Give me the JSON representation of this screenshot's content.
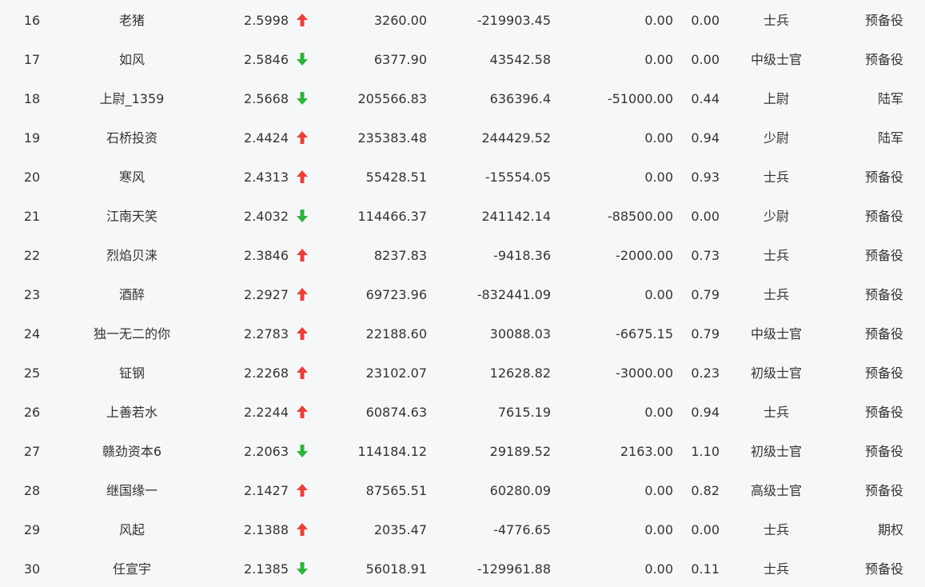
{
  "colors": {
    "up": "#e8413c",
    "down": "#2fb23f",
    "text": "#333333",
    "background": "#f6f7f9"
  },
  "rows": [
    {
      "rank": "16",
      "name": "老猪",
      "score": "2.5998",
      "trend": "up",
      "trend_icon": "arrow-up-icon",
      "value1": "3260.00",
      "value2": "-219903.45",
      "value3": "0.00",
      "ratio": "0.00",
      "title": "士兵",
      "category": "预备役"
    },
    {
      "rank": "17",
      "name": "如风",
      "score": "2.5846",
      "trend": "down",
      "trend_icon": "arrow-down-icon",
      "value1": "6377.90",
      "value2": "43542.58",
      "value3": "0.00",
      "ratio": "0.00",
      "title": "中级士官",
      "category": "预备役"
    },
    {
      "rank": "18",
      "name": "上尉_1359",
      "score": "2.5668",
      "trend": "down",
      "trend_icon": "arrow-down-icon",
      "value1": "205566.83",
      "value2": "636396.4",
      "value3": "-51000.00",
      "ratio": "0.44",
      "title": "上尉",
      "category": "陆军"
    },
    {
      "rank": "19",
      "name": "石桥投资",
      "score": "2.4424",
      "trend": "up",
      "trend_icon": "arrow-up-icon",
      "value1": "235383.48",
      "value2": "244429.52",
      "value3": "0.00",
      "ratio": "0.94",
      "title": "少尉",
      "category": "陆军"
    },
    {
      "rank": "20",
      "name": "寒风",
      "score": "2.4313",
      "trend": "up",
      "trend_icon": "arrow-up-icon",
      "value1": "55428.51",
      "value2": "-15554.05",
      "value3": "0.00",
      "ratio": "0.93",
      "title": "士兵",
      "category": "预备役"
    },
    {
      "rank": "21",
      "name": "江南天笑",
      "score": "2.4032",
      "trend": "down",
      "trend_icon": "arrow-down-icon",
      "value1": "114466.37",
      "value2": "241142.14",
      "value3": "-88500.00",
      "ratio": "0.00",
      "title": "少尉",
      "category": "预备役"
    },
    {
      "rank": "22",
      "name": "烈焰贝涞",
      "score": "2.3846",
      "trend": "up",
      "trend_icon": "arrow-up-icon",
      "value1": "8237.83",
      "value2": "-9418.36",
      "value3": "-2000.00",
      "ratio": "0.73",
      "title": "士兵",
      "category": "预备役"
    },
    {
      "rank": "23",
      "name": "酒醉",
      "score": "2.2927",
      "trend": "up",
      "trend_icon": "arrow-up-icon",
      "value1": "69723.96",
      "value2": "-832441.09",
      "value3": "0.00",
      "ratio": "0.79",
      "title": "士兵",
      "category": "预备役"
    },
    {
      "rank": "24",
      "name": "独一无二的你",
      "score": "2.2783",
      "trend": "up",
      "trend_icon": "arrow-up-icon",
      "value1": "22188.60",
      "value2": "30088.03",
      "value3": "-6675.15",
      "ratio": "0.79",
      "title": "中级士官",
      "category": "预备役"
    },
    {
      "rank": "25",
      "name": "钲钢",
      "score": "2.2268",
      "trend": "up",
      "trend_icon": "arrow-up-icon",
      "value1": "23102.07",
      "value2": "12628.82",
      "value3": "-3000.00",
      "ratio": "0.23",
      "title": "初级士官",
      "category": "预备役"
    },
    {
      "rank": "26",
      "name": "上善若水",
      "score": "2.2244",
      "trend": "up",
      "trend_icon": "arrow-up-icon",
      "value1": "60874.63",
      "value2": "7615.19",
      "value3": "0.00",
      "ratio": "0.94",
      "title": "士兵",
      "category": "预备役"
    },
    {
      "rank": "27",
      "name": "赣劲资本6",
      "score": "2.2063",
      "trend": "down",
      "trend_icon": "arrow-down-icon",
      "value1": "114184.12",
      "value2": "29189.52",
      "value3": "2163.00",
      "ratio": "1.10",
      "title": "初级士官",
      "category": "预备役"
    },
    {
      "rank": "28",
      "name": "继国缘一",
      "score": "2.1427",
      "trend": "up",
      "trend_icon": "arrow-up-icon",
      "value1": "87565.51",
      "value2": "60280.09",
      "value3": "0.00",
      "ratio": "0.82",
      "title": "高级士官",
      "category": "预备役"
    },
    {
      "rank": "29",
      "name": "风起",
      "score": "2.1388",
      "trend": "up",
      "trend_icon": "arrow-up-icon",
      "value1": "2035.47",
      "value2": "-4776.65",
      "value3": "0.00",
      "ratio": "0.00",
      "title": "士兵",
      "category": "期权"
    },
    {
      "rank": "30",
      "name": "任宣宇",
      "score": "2.1385",
      "trend": "down",
      "trend_icon": "arrow-down-icon",
      "value1": "56018.91",
      "value2": "-129961.88",
      "value3": "0.00",
      "ratio": "0.11",
      "title": "士兵",
      "category": "预备役"
    }
  ]
}
